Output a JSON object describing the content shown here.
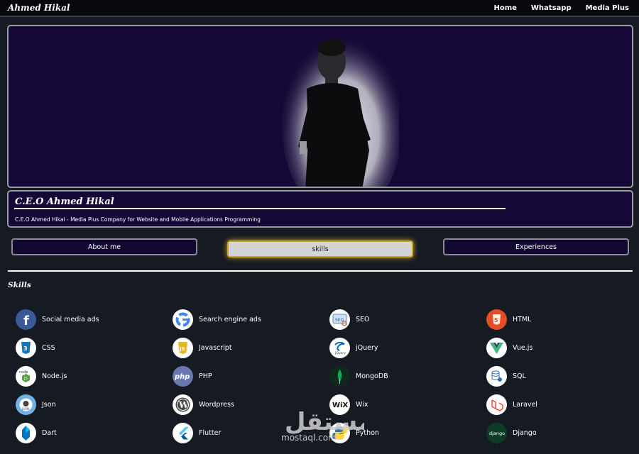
{
  "brand": "Ahmed Hikal",
  "nav": {
    "home": "Home",
    "whatsapp": "Whatsapp",
    "media_plus": "Media Plus"
  },
  "profile": {
    "title": "C.E.O Ahmed Hikal",
    "subtitle": "C.E.O Ahmed Hikal - Media Plus Company for Website and Mobile Applications Programming"
  },
  "tabs": {
    "about": "About me",
    "skills": "skills",
    "experiences": "Experiences"
  },
  "skills_heading": "Skills",
  "skills": [
    {
      "label": "Social media ads",
      "icon": "facebook-icon"
    },
    {
      "label": "Search engine ads",
      "icon": "google-icon"
    },
    {
      "label": "SEO",
      "icon": "seo-icon"
    },
    {
      "label": "HTML",
      "icon": "html5-icon"
    },
    {
      "label": "CSS",
      "icon": "css3-icon"
    },
    {
      "label": "Javascript",
      "icon": "javascript-icon"
    },
    {
      "label": "jQuery",
      "icon": "jquery-icon"
    },
    {
      "label": "Vue.js",
      "icon": "vuejs-icon"
    },
    {
      "label": "Node.js",
      "icon": "nodejs-icon"
    },
    {
      "label": "PHP",
      "icon": "php-icon"
    },
    {
      "label": "MongoDB",
      "icon": "mongodb-icon"
    },
    {
      "label": "SQL",
      "icon": "sql-icon"
    },
    {
      "label": "Json",
      "icon": "json-icon"
    },
    {
      "label": "Wordpress",
      "icon": "wordpress-icon"
    },
    {
      "label": "Wix",
      "icon": "wix-icon"
    },
    {
      "label": "Laravel",
      "icon": "laravel-icon"
    },
    {
      "label": "Dart",
      "icon": "dart-icon"
    },
    {
      "label": "Flutter",
      "icon": "flutter-icon"
    },
    {
      "label": "Python",
      "icon": "python-icon"
    },
    {
      "label": "Django",
      "icon": "django-icon"
    }
  ],
  "watermark": {
    "arabic": "مستقل",
    "latin": "mostaql.com"
  },
  "colors": {
    "background": "#161a23",
    "card": "#160836",
    "active_tab_glow": "#d4a820"
  }
}
